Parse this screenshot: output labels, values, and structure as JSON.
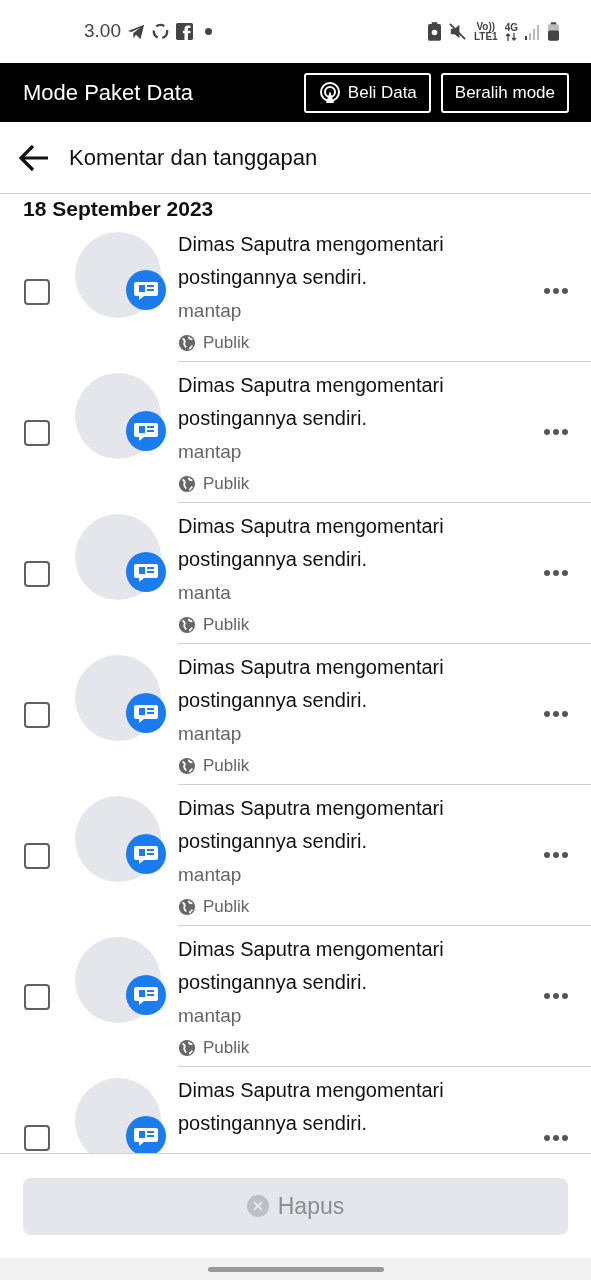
{
  "status_bar": {
    "time": "3.00",
    "volte": "Vo))",
    "lte": "LTE1",
    "network": "4G"
  },
  "mode_bar": {
    "title": "Mode Paket Data",
    "buttons": [
      "Beli Data",
      "Beralih mode"
    ]
  },
  "header": {
    "title": "Komentar dan tanggapan"
  },
  "date": "18 September 2023",
  "items": [
    {
      "title": "Dimas Saputra mengomentari postingannya sendiri.",
      "snippet": "mantap",
      "privacy": "Publik",
      "checked": false
    },
    {
      "title": "Dimas Saputra mengomentari postingannya sendiri.",
      "snippet": "mantap",
      "privacy": "Publik",
      "checked": false
    },
    {
      "title": "Dimas Saputra mengomentari postingannya sendiri.",
      "snippet": "manta",
      "privacy": "Publik",
      "checked": false
    },
    {
      "title": "Dimas Saputra mengomentari postingannya sendiri.",
      "snippet": "mantap",
      "privacy": "Publik",
      "checked": false
    },
    {
      "title": "Dimas Saputra mengomentari postingannya sendiri.",
      "snippet": "mantap",
      "privacy": "Publik",
      "checked": false
    },
    {
      "title": "Dimas Saputra mengomentari postingannya sendiri.",
      "snippet": "mantap",
      "privacy": "Publik",
      "checked": false
    },
    {
      "title": "Dimas Saputra mengomentari postingannya sendiri.",
      "checked": false
    }
  ],
  "delete_button": {
    "label": "Hapus",
    "disabled": true
  }
}
